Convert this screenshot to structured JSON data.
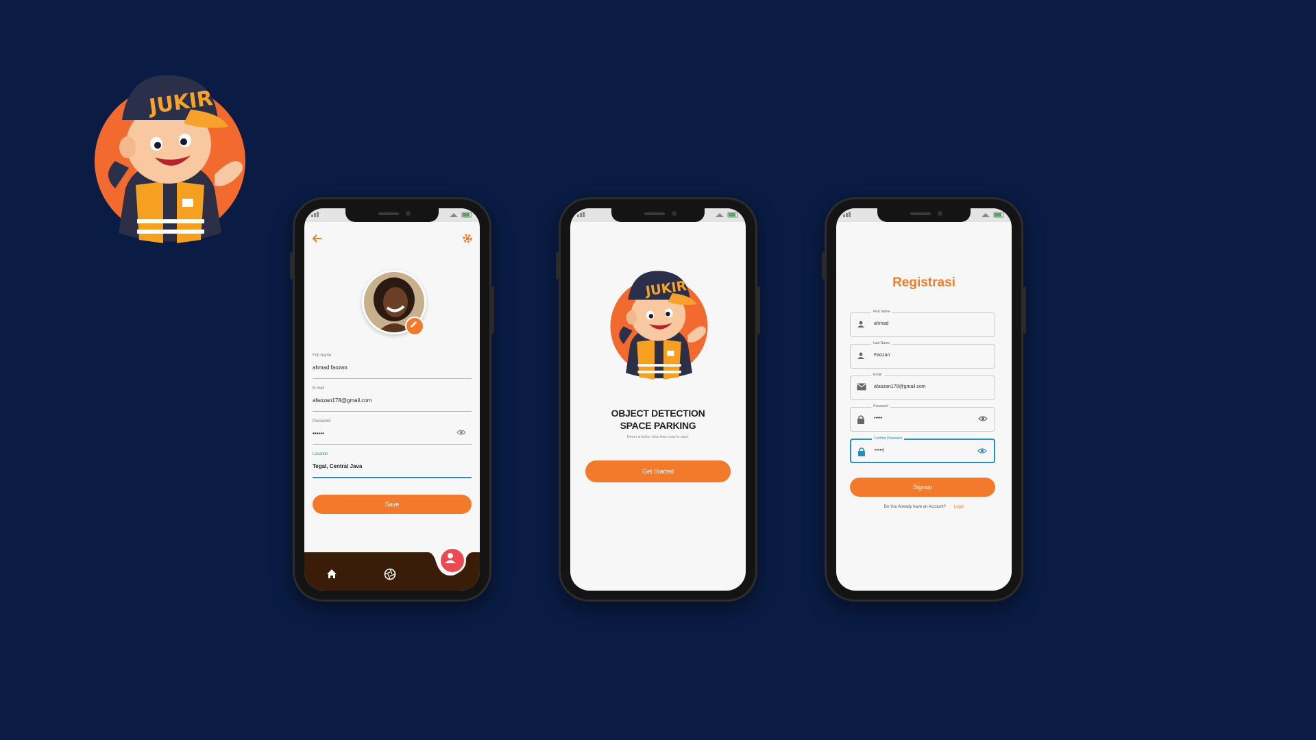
{
  "logo": {
    "brand_text": "JUKIR"
  },
  "colors": {
    "background": "#0a1c44",
    "accent": "#f47a2b",
    "focus": "#2a8fb8",
    "nav_brown": "#3a1d08",
    "fab": "#ec4a53"
  },
  "profile_screen": {
    "fields": [
      {
        "label": "Full Name",
        "value": "ahmad faozan"
      },
      {
        "label": "E-mail",
        "value": "afaozan178@gmail.com"
      },
      {
        "label": "Password",
        "value": "••••••"
      },
      {
        "label": "Location",
        "value": "Tegal, Central Java"
      }
    ],
    "save_label": "Save",
    "icons": {
      "back": "arrow-left-icon",
      "settings": "gear-icon",
      "edit": "pencil-icon",
      "home": "home-icon",
      "camera": "camera-shutter-icon",
      "profile": "person-icon"
    }
  },
  "welcome_screen": {
    "title_line1": "OBJECT DETECTION",
    "title_line2": "SPACE PARKING",
    "subtitle": "Never a better time than now to start.",
    "button_label": "Get Started"
  },
  "register_screen": {
    "title": "Registrasi",
    "fields": [
      {
        "label": "First Name",
        "value": "ahmad",
        "icon": "person-icon"
      },
      {
        "label": "Last Name",
        "value": "Faozan",
        "icon": "person-icon"
      },
      {
        "label": "Email",
        "value": "afaozan178@gmail.com",
        "icon": "mail-icon"
      },
      {
        "label": "Password",
        "value": "•••••",
        "icon": "lock-icon"
      },
      {
        "label": "Confirm Password",
        "value": "•••••|",
        "icon": "lock-icon"
      }
    ],
    "button_label": "Signup",
    "footer_text": "Do You Already have an Account?",
    "footer_link": "Login"
  }
}
